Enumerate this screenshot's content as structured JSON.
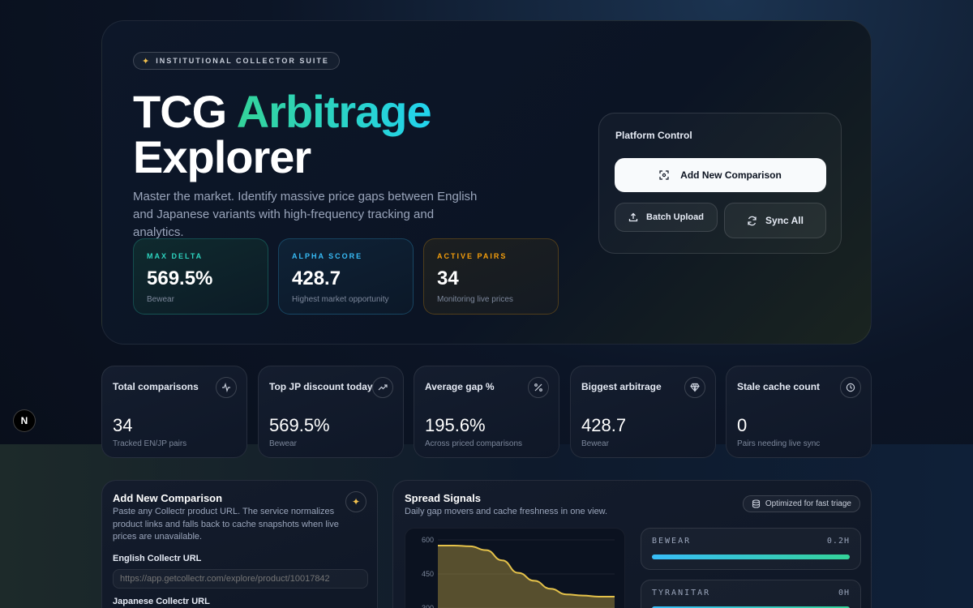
{
  "hero": {
    "pill": "INSTITUTIONAL COLLECTOR SUITE",
    "title_part1": "TCG",
    "title_part2": "Arbitrage",
    "title_part3": "Explorer",
    "subtitle": "Master the market. Identify massive price gaps between English and Japanese variants with high-frequency tracking and analytics.",
    "cards": [
      {
        "label": "MAX DELTA",
        "value": "569.5%",
        "sub": "Bewear"
      },
      {
        "label": "ALPHA SCORE",
        "value": "428.7",
        "sub": "Highest market opportunity"
      },
      {
        "label": "ACTIVE PAIRS",
        "value": "34",
        "sub": "Monitoring live prices"
      }
    ]
  },
  "control": {
    "title": "Platform Control",
    "add_label": "Add New Comparison",
    "upload_label": "Batch Upload",
    "sync_label": "Sync All"
  },
  "stats": [
    {
      "title": "Total comparisons",
      "value": "34",
      "sub": "Tracked EN/JP pairs",
      "icon": "activity-icon"
    },
    {
      "title": "Top JP discount today",
      "value": "569.5%",
      "sub": "Bewear",
      "icon": "trending-up-icon"
    },
    {
      "title": "Average gap %",
      "value": "195.6%",
      "sub": "Across priced comparisons",
      "icon": "percent-icon"
    },
    {
      "title": "Biggest arbitrage",
      "value": "428.7",
      "sub": "Bewear",
      "icon": "diamond-icon"
    },
    {
      "title": "Stale cache count",
      "value": "0",
      "sub": "Pairs needing live sync",
      "icon": "clock-icon"
    }
  ],
  "nextjs_logo": "N",
  "add_form": {
    "title": "Add New Comparison",
    "desc": "Paste any Collectr product URL. The service normalizes product links and falls back to cache snapshots when live prices are unavailable.",
    "en_label": "English Collectr URL",
    "en_placeholder": "https://app.getcollectr.com/explore/product/10017842",
    "jp_label": "Japanese Collectr URL"
  },
  "signals": {
    "title": "Spread Signals",
    "desc": "Daily gap movers and cache freshness in one view.",
    "badge": "Optimized for fast triage",
    "movers": [
      {
        "name": "BEWEAR",
        "age": "0.2H",
        "fill": 1.0
      },
      {
        "name": "TYRANITAR",
        "age": "0H",
        "fill": 1.0
      }
    ]
  },
  "chart_data": {
    "type": "area",
    "y_ticks": [
      "600",
      "450",
      "300"
    ],
    "ylim": [
      300,
      600
    ],
    "x": [
      0,
      1,
      2,
      3,
      4,
      5,
      6,
      7,
      8,
      9,
      10,
      11
    ],
    "values": [
      575,
      575,
      572,
      555,
      510,
      455,
      420,
      385,
      360,
      355,
      350,
      350
    ],
    "color": "#e5c24a"
  },
  "colors": {
    "accent_green": "#34d399",
    "accent_cyan": "#22d3ee",
    "accent_amber": "#f59e0b",
    "accent_sky": "#38bdf8"
  }
}
